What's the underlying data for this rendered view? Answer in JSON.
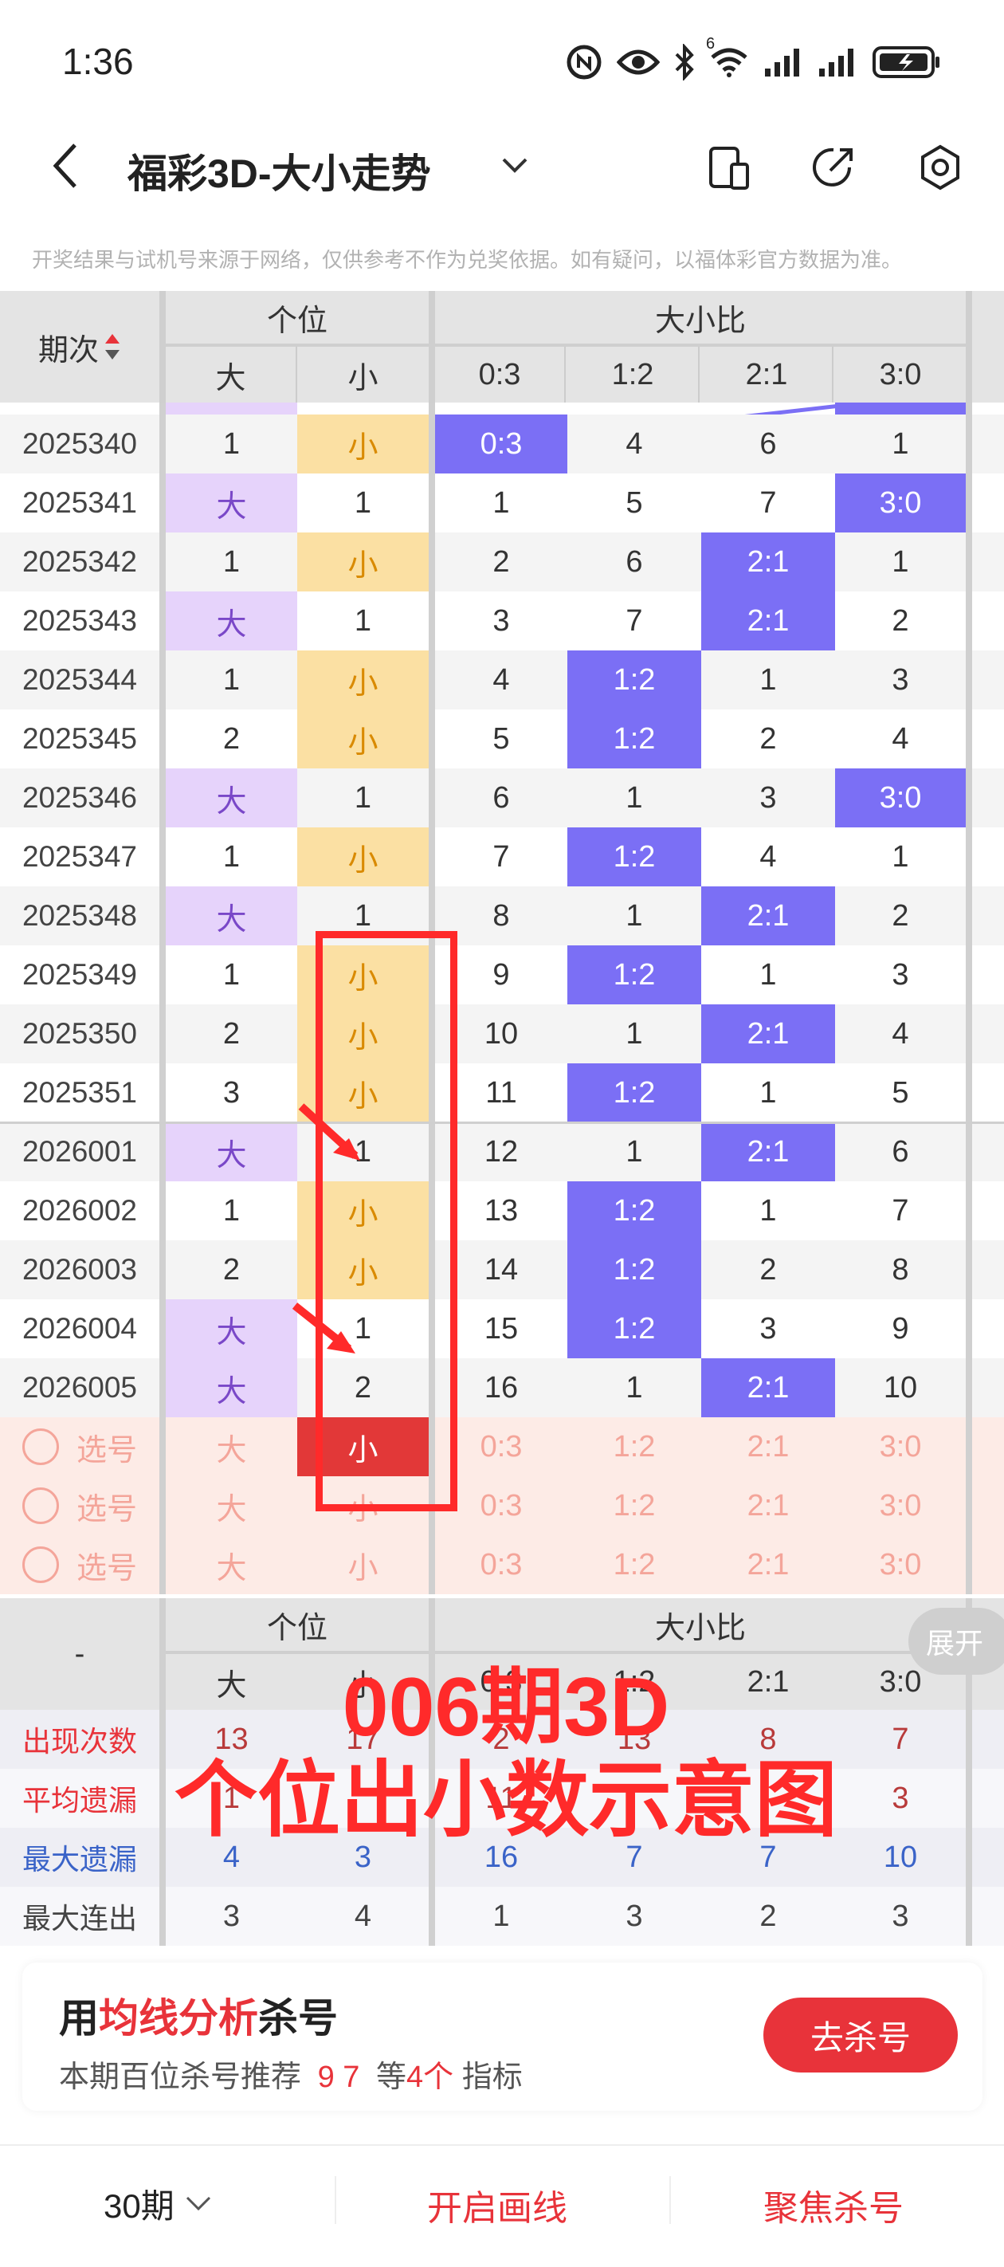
{
  "status_bar": {
    "time": "1:36",
    "network_label": "6"
  },
  "app_bar": {
    "title": "福彩3D-大小走势"
  },
  "notice": "开奖结果与试机号来源于网络，仅供参考不作为兑奖依据。如有疑问，以福体彩官方数据为准。",
  "table_header": {
    "period_label": "期次",
    "group_geiwei": "个位",
    "group_ratio": "大小比",
    "col_big": "大",
    "col_small": "小",
    "ratio_cols": [
      "0:3",
      "1:2",
      "2:1",
      "3:0"
    ]
  },
  "rows": [
    {
      "period": "2025340",
      "big": "1",
      "small": "小",
      "r03": "0:3",
      "r12": "4",
      "r21": "6",
      "r30": "1"
    },
    {
      "period": "2025341",
      "big": "大",
      "small": "1",
      "r03": "1",
      "r12": "5",
      "r21": "7",
      "r30": "3:0"
    },
    {
      "period": "2025342",
      "big": "1",
      "small": "小",
      "r03": "2",
      "r12": "6",
      "r21": "2:1",
      "r30": "1"
    },
    {
      "period": "2025343",
      "big": "大",
      "small": "1",
      "r03": "3",
      "r12": "7",
      "r21": "2:1",
      "r30": "2"
    },
    {
      "period": "2025344",
      "big": "1",
      "small": "小",
      "r03": "4",
      "r12": "1:2",
      "r21": "1",
      "r30": "3"
    },
    {
      "period": "2025345",
      "big": "2",
      "small": "小",
      "r03": "5",
      "r12": "1:2",
      "r21": "2",
      "r30": "4"
    },
    {
      "period": "2025346",
      "big": "大",
      "small": "1",
      "r03": "6",
      "r12": "1",
      "r21": "3",
      "r30": "3:0"
    },
    {
      "period": "2025347",
      "big": "1",
      "small": "小",
      "r03": "7",
      "r12": "1:2",
      "r21": "4",
      "r30": "1"
    },
    {
      "period": "2025348",
      "big": "大",
      "small": "1",
      "r03": "8",
      "r12": "1",
      "r21": "2:1",
      "r30": "2"
    },
    {
      "period": "2025349",
      "big": "1",
      "small": "小",
      "r03": "9",
      "r12": "1:2",
      "r21": "1",
      "r30": "3"
    },
    {
      "period": "2025350",
      "big": "2",
      "small": "小",
      "r03": "10",
      "r12": "1",
      "r21": "2:1",
      "r30": "4"
    },
    {
      "period": "2025351",
      "big": "3",
      "small": "小",
      "r03": "11",
      "r12": "1:2",
      "r21": "1",
      "r30": "5"
    },
    {
      "period": "2026001",
      "big": "大",
      "small": "1",
      "r03": "12",
      "r12": "1",
      "r21": "2:1",
      "r30": "6"
    },
    {
      "period": "2026002",
      "big": "1",
      "small": "小",
      "r03": "13",
      "r12": "1:2",
      "r21": "1",
      "r30": "7"
    },
    {
      "period": "2026003",
      "big": "2",
      "small": "小",
      "r03": "14",
      "r12": "1:2",
      "r21": "2",
      "r30": "8"
    },
    {
      "period": "2026004",
      "big": "大",
      "small": "1",
      "r03": "15",
      "r12": "1:2",
      "r21": "3",
      "r30": "9"
    },
    {
      "period": "2026005",
      "big": "大",
      "small": "2",
      "r03": "16",
      "r12": "1",
      "r21": "2:1",
      "r30": "10"
    }
  ],
  "select_rows": [
    {
      "label": "选号",
      "big": "大",
      "small": "小",
      "r03": "0:3",
      "r12": "1:2",
      "r21": "2:1",
      "r30": "3:0"
    },
    {
      "label": "选号",
      "big": "大",
      "small": "小",
      "r03": "0:3",
      "r12": "1:2",
      "r21": "2:1",
      "r30": "3:0"
    },
    {
      "label": "选号",
      "big": "大",
      "small": "小",
      "r03": "0:3",
      "r12": "1:2",
      "r21": "2:1",
      "r30": "3:0"
    }
  ],
  "stats": {
    "dash": "-",
    "expand_label": "展开",
    "group_geiwei": "个位",
    "group_ratio": "大小比",
    "col_big": "大",
    "col_small": "小",
    "ratio_cols": [
      "0:3",
      "1:2",
      "2:1",
      "3:0"
    ],
    "rows": [
      {
        "label": "出现次数",
        "values": [
          "13",
          "17",
          "2",
          "13",
          "8",
          "7"
        ]
      },
      {
        "label": "平均遗漏",
        "values": [
          "1",
          "",
          "11",
          "",
          "",
          "3"
        ]
      },
      {
        "label": "最大遗漏",
        "values": [
          "4",
          "3",
          "16",
          "7",
          "7",
          "10"
        ]
      },
      {
        "label": "最大连出",
        "values": [
          "3",
          "4",
          "1",
          "3",
          "2",
          "3"
        ]
      }
    ]
  },
  "overlay": {
    "line1": "006期3D",
    "line2": "个位出小数示意图"
  },
  "promo": {
    "title_prefix": "用",
    "title_highlight": "均线分析",
    "title_suffix": "杀号",
    "sub_prefix": "本期百位杀号推荐",
    "sub_numbers": "9 7",
    "sub_mid": "等",
    "sub_count": "4个",
    "sub_suffix": "指标",
    "button": "去杀号"
  },
  "footer": {
    "periods": "30期",
    "draw_line": "开启画线",
    "focus_kill": "聚焦杀号"
  },
  "colors": {
    "big_hit": "#e6d3fb",
    "small_hit": "#fbe0a3",
    "ratio_hit": "#7b6ff5",
    "accent_red": "#e8333a",
    "annotation_red": "#ff2a2a"
  }
}
